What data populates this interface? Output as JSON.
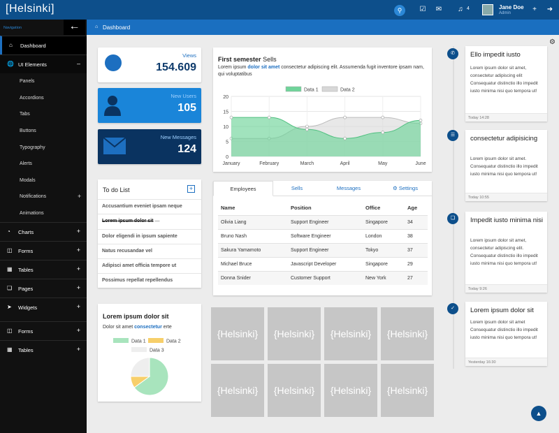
{
  "topbar": {
    "logo": "[Helsinki]",
    "user_name": "Jane Doe",
    "user_role": "Admin",
    "notifications_count": "4",
    "icons": {
      "search": "search-icon",
      "tasks": "checkbox-icon",
      "messages": "chat-icon",
      "notifications": "bell-icon",
      "add": "plus-icon",
      "logout": "logout-icon"
    }
  },
  "sidebar": {
    "nav_label": "Navigation",
    "items": [
      {
        "label": "Dashboard",
        "icon": "home-icon",
        "toggle": ""
      },
      {
        "label": "UI Elements",
        "icon": "globe-icon",
        "toggle": "–"
      },
      {
        "label": "Charts",
        "icon": "pie-chart-icon",
        "toggle": "+"
      },
      {
        "label": "Forms",
        "icon": "columns-icon",
        "toggle": "+"
      },
      {
        "label": "Tables",
        "icon": "table-icon",
        "toggle": "+"
      },
      {
        "label": "Pages",
        "icon": "copy-icon",
        "toggle": "+"
      },
      {
        "label": "Widgets",
        "icon": "paper-plane-icon",
        "toggle": "+"
      },
      {
        "label": "Forms",
        "icon": "columns-icon",
        "toggle": "+"
      },
      {
        "label": "Tables",
        "icon": "table-icon",
        "toggle": "+"
      }
    ],
    "subitems": [
      "Panels",
      "Accordions",
      "Tabs",
      "Buttons",
      "Typography",
      "Alerts",
      "Modals",
      "Notifications",
      "Animations"
    ]
  },
  "breadcrumb": {
    "title": "Dashboard"
  },
  "stats": [
    {
      "label": "Views",
      "value": "154.609",
      "bg": "#ffffff",
      "fg": "#0d3a6b"
    },
    {
      "label": "New Users",
      "value": "105",
      "bg": "#1a85d9",
      "fg": "#ffffff"
    },
    {
      "label": "New Messages",
      "value": "124",
      "bg": "#0a3360",
      "fg": "#ffffff"
    }
  ],
  "semester": {
    "title_bold": "First semester",
    "title_rest": "Sells",
    "text_before": "Lorem ipsum ",
    "text_link": "dolor sit amet",
    "text_after": " consectetur adipiscing elit. Assumenda fugit inventore ipsam nam, qui voluptatibus"
  },
  "chart_data": {
    "type": "area",
    "categories": [
      "January",
      "February",
      "March",
      "April",
      "May",
      "June"
    ],
    "ylim": [
      0,
      20
    ],
    "yticks": [
      0,
      5,
      10,
      15,
      20
    ],
    "grid": true,
    "legend": "top",
    "series": [
      {
        "name": "Data 1",
        "values": [
          13,
          13,
          9,
          6,
          8,
          12
        ],
        "color": "#6fd49a"
      },
      {
        "name": "Data 2",
        "values": [
          6,
          6,
          10,
          13,
          13,
          11
        ],
        "color": "#d8d8d8"
      }
    ]
  },
  "todo": {
    "title": "To do List",
    "add": "+",
    "items": [
      "Accusantium eveniet ipsam neque",
      "Lorem ipsum dolor sit",
      "Dolor eligendi in ipsum sapiente",
      "Natus recusandae vel",
      "Adipisci amet officia tempore ut",
      "Possimus repellat repellendus"
    ],
    "done_suffix": " —"
  },
  "employees": {
    "tabs": [
      "Employees",
      "Sells",
      "Messages",
      "Settings"
    ],
    "headers": [
      "Name",
      "Position",
      "Office",
      "Age"
    ],
    "rows": [
      [
        "Olivia Liang",
        "Support Engineer",
        "Singapore",
        "34"
      ],
      [
        "Bruno Nash",
        "Software Engineer",
        "London",
        "38"
      ],
      [
        "Sakura Yamamoto",
        "Support Engineer",
        "Tokyo",
        "37"
      ],
      [
        "Michael Bruce",
        "Javascript Developer",
        "Singapore",
        "29"
      ],
      [
        "Donna Snider",
        "Customer Support",
        "New York",
        "27"
      ]
    ]
  },
  "pie": {
    "title": "Lorem ipsum dolor sit",
    "sub_before": "Dolor sit amet ",
    "sub_link": "consectetur",
    "sub_after": " erte",
    "chart_data": {
      "type": "pie",
      "legend": "top",
      "labels": [
        "Data 1",
        "Data 2",
        "Data 3"
      ],
      "values": [
        65,
        10,
        25
      ],
      "colors": [
        "#a8e4bd",
        "#f7cf6a",
        "#eeeeee"
      ]
    }
  },
  "gallery": {
    "tile_label": "{Helsinki}"
  },
  "timeline": [
    {
      "title": "Ello impedit iusto",
      "body": "Lorem ipsum dolor sit amet, consectetur adipiscing elit Consequatur distinctio illo impedit iusto minima nisi quo tempora ut!",
      "time": "Today 14:28",
      "icon": "phone-icon"
    },
    {
      "title": "consectetur adipisicing",
      "body": "Lorem ipsum dolor sit amet. Consequatur distinctio illo impedit iusto minima nisi quo tempora ut!",
      "time": "Today 10:55",
      "icon": "list-icon"
    },
    {
      "title": "Impedit iusto minima nisi",
      "body": "Lorem ipsum dolor sit amet, consectetur adipiscing elit. Consequatur distinctio illo impedit iusto minima nisi quo tempora ut!",
      "time": "Today 9:26",
      "icon": "file-icon"
    },
    {
      "title": "Lorem ipsum dolor sit",
      "body": "Lorem ipsum dolor sit amet Consequatur distinctio illo impedit iusto minima nisi quo tempora ut!",
      "time": "Yesterday 16:30",
      "icon": "check-icon"
    }
  ]
}
